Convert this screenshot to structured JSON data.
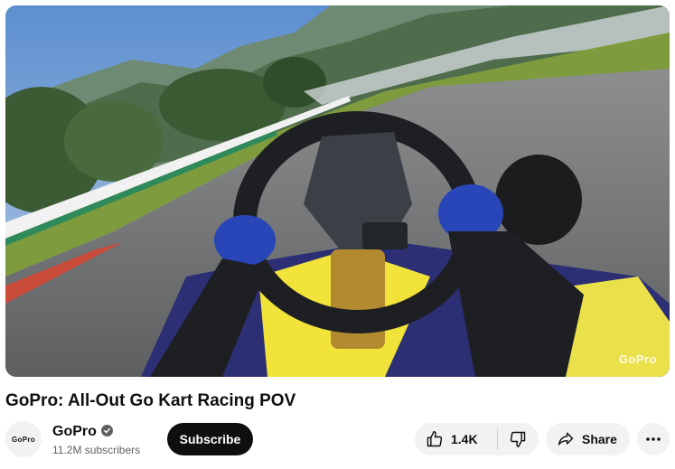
{
  "video": {
    "title": "GoPro: All-Out Go Kart Racing POV",
    "watermark": "GoPro"
  },
  "channel": {
    "name": "GoPro",
    "subscribers": "11.2M subscribers",
    "avatar_logo": "GoPro"
  },
  "actions": {
    "subscribe_label": "Subscribe",
    "like_count": "1.4K",
    "share_label": "Share"
  },
  "icons": {
    "verified": "verified-check-icon",
    "like": "thumbs-up-icon",
    "dislike": "thumbs-down-icon",
    "share": "share-arrow-icon",
    "more": "more-horizontal-icon"
  },
  "colors": {
    "subscribe_bg": "#0f0f0f",
    "pill_bg": "#f2f2f2",
    "secondary_text": "#606060"
  }
}
